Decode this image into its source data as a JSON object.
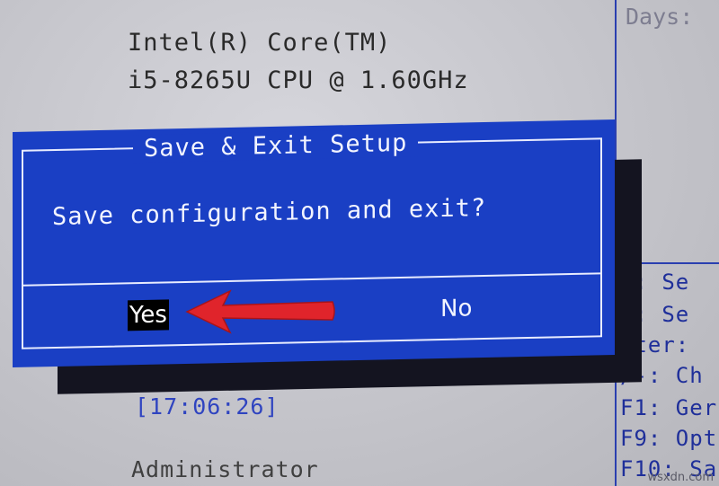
{
  "background": {
    "cpu_line1": "Intel(R) Core(TM)",
    "cpu_line2": "i5-8265U CPU @ 1.60GHz",
    "time": "[17:06:26]",
    "admin": "Administrator",
    "days_label": "Days:"
  },
  "help_panel": {
    "lines": [
      "↔: Se",
      "↕: Se",
      "nter: ",
      "/-: Ch",
      "F1: Ger",
      "F9: Opt",
      "F10: Sa"
    ]
  },
  "dialog": {
    "title": "Save & Exit Setup",
    "message": "Save configuration and exit?",
    "yes_label": "Yes",
    "no_label": "No",
    "selected": "Yes"
  },
  "annotation": {
    "arrow_color": "#e0242b",
    "points_to": "Yes"
  },
  "watermark": "wsxdn.com",
  "colors": {
    "dialog_bg": "#1a3fc4",
    "dialog_text": "#f2f4ff",
    "selected_bg": "#000000",
    "screen_bg": "#c6c6cc",
    "accent_blue": "#2f44c0"
  }
}
